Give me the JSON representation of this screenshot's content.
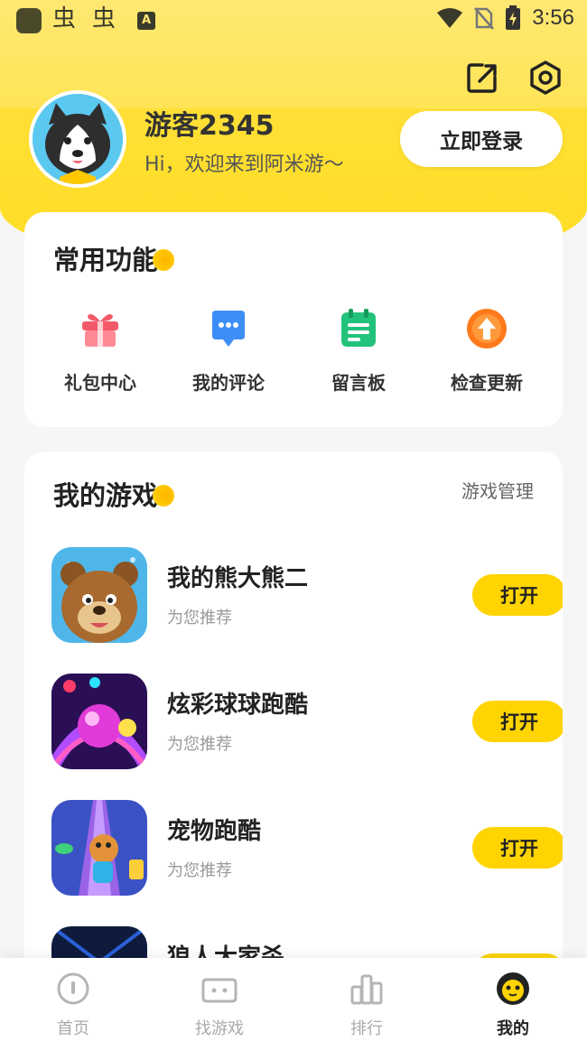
{
  "status_bar": {
    "app_glyph_1": "虫",
    "app_glyph_2": "虫",
    "a_badge": "A",
    "time": "3:56"
  },
  "profile": {
    "username": "游客2345",
    "welcome": "Hi，欢迎来到阿米游～",
    "login_label": "立即登录"
  },
  "functions": {
    "title": "常用功能",
    "items": [
      {
        "label": "礼包中心",
        "icon": "gift-icon",
        "color": "#f25a6a"
      },
      {
        "label": "我的评论",
        "icon": "comment-icon",
        "color": "#3d8ef5"
      },
      {
        "label": "留言板",
        "icon": "board-icon",
        "color": "#22c27a"
      },
      {
        "label": "检查更新",
        "icon": "update-icon",
        "color": "#ff7a1a"
      }
    ]
  },
  "games": {
    "title": "我的游戏",
    "manage_label": "游戏管理",
    "items": [
      {
        "name": "我的熊大熊二",
        "sub": "为您推荐",
        "action": "打开"
      },
      {
        "name": "炫彩球球跑酷",
        "sub": "为您推荐",
        "action": "打开"
      },
      {
        "name": "宠物跑酷",
        "sub": "为您推荐",
        "action": "打开"
      },
      {
        "name": "狼人大家杀",
        "sub": "",
        "action": ""
      }
    ]
  },
  "tabs": [
    {
      "label": "首页",
      "icon": "home-icon",
      "active": false
    },
    {
      "label": "找游戏",
      "icon": "gamepad-icon",
      "active": false
    },
    {
      "label": "排行",
      "icon": "ranking-icon",
      "active": false
    },
    {
      "label": "我的",
      "icon": "mine-icon",
      "active": true
    }
  ],
  "colors": {
    "brand_yellow": "#ffd400",
    "header_yellow": "#ffe34a"
  }
}
